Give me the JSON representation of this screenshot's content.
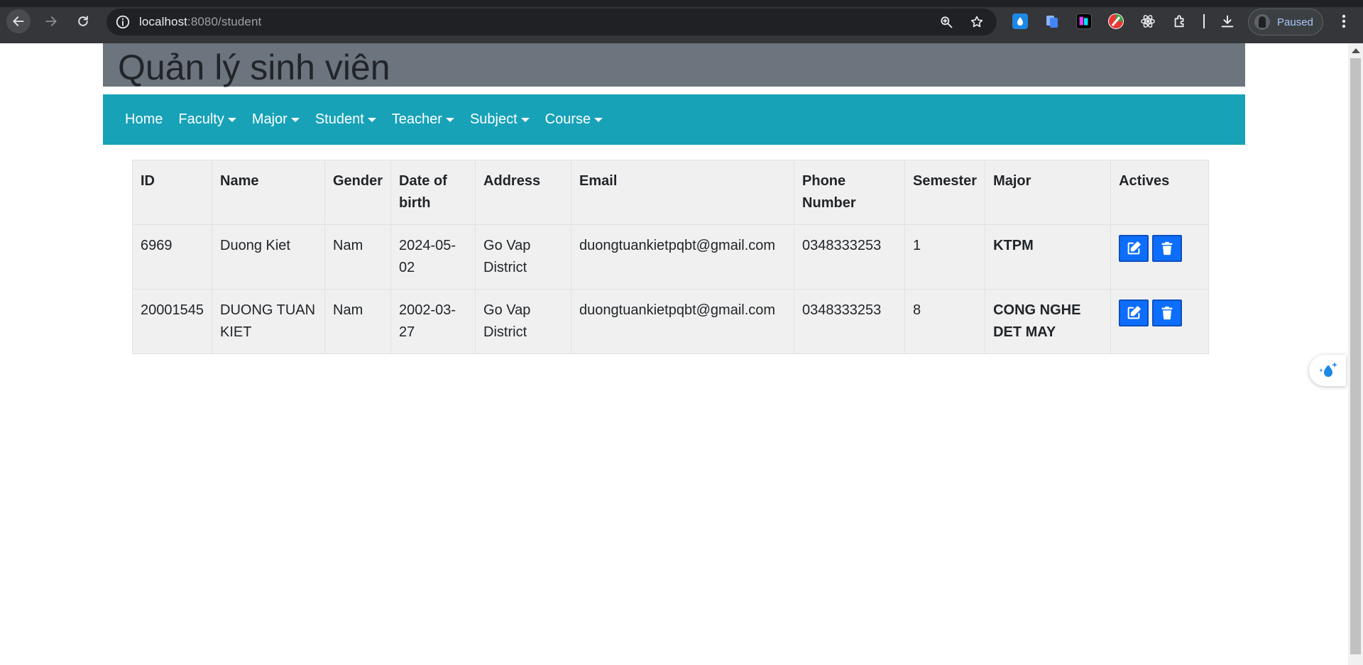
{
  "browser": {
    "url_host": "localhost",
    "url_path": ":8080/student",
    "profile_status": "Paused"
  },
  "page": {
    "title": "Quản lý sinh viên"
  },
  "nav": {
    "items": [
      {
        "label": "Home",
        "dropdown": false
      },
      {
        "label": "Faculty",
        "dropdown": true
      },
      {
        "label": "Major",
        "dropdown": true
      },
      {
        "label": "Student",
        "dropdown": true
      },
      {
        "label": "Teacher",
        "dropdown": true
      },
      {
        "label": "Subject",
        "dropdown": true
      },
      {
        "label": "Course",
        "dropdown": true
      }
    ]
  },
  "table": {
    "headers": [
      "ID",
      "Name",
      "Gender",
      "Date of birth",
      "Address",
      "Email",
      "Phone Number",
      "Semester",
      "Major",
      "Actives"
    ],
    "rows": [
      {
        "id": "6969",
        "name": "Duong Kiet",
        "gender": "Nam",
        "dob": "2024-05-02",
        "address": "Go Vap District",
        "email": "duongtuankietpqbt@gmail.com",
        "phone": "0348333253",
        "semester": "1",
        "major": "KTPM"
      },
      {
        "id": "20001545",
        "name": "DUONG TUAN KIET",
        "gender": "Nam",
        "dob": "2002-03-27",
        "address": "Go Vap District",
        "email": "duongtuankietpqbt@gmail.com",
        "phone": "0348333253",
        "semester": "8",
        "major": "CONG NGHE DET MAY"
      }
    ]
  },
  "colors": {
    "header_bg": "#6c757d",
    "navbar_bg": "#17a2b8",
    "action_button": "#0d6efd",
    "table_bg": "#f0f0f0"
  },
  "icons": [
    "back-icon",
    "forward-icon",
    "reload-icon",
    "site-info-icon",
    "zoom-icon",
    "bookmark-star-icon",
    "extensions-icon",
    "download-icon",
    "menu-kebab-icon",
    "edit-icon",
    "trash-icon"
  ]
}
